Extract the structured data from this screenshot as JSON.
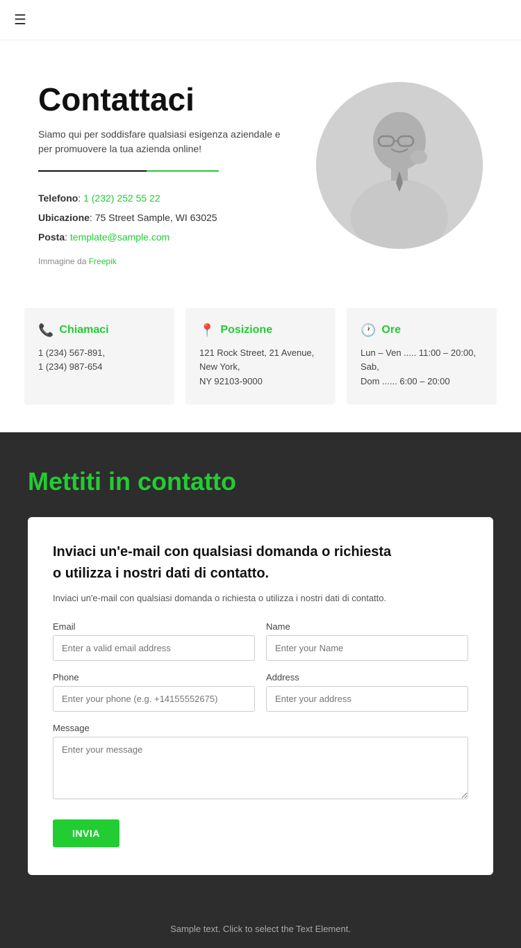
{
  "header": {
    "menu_icon": "☰"
  },
  "hero": {
    "title": "Contattaci",
    "subtitle": "Siamo qui per soddisfare qualsiasi esigenza aziendale e per promuovere la tua azienda online!",
    "telefono_label": "Telefono",
    "telefono_value": "1 (232) 252 55 22",
    "ubicazione_label": "Ubicazione",
    "ubicazione_value": "75 Street Sample, WI 63025",
    "posta_label": "Posta",
    "posta_value": "template@sample.com",
    "image_credit_prefix": "Immagine da",
    "image_credit_link": "Freepik"
  },
  "cards": [
    {
      "icon": "📞",
      "title": "Chiamaci",
      "line1": "1 (234) 567-891,",
      "line2": "1 (234) 987-654"
    },
    {
      "icon": "📍",
      "title": "Posizione",
      "line1": "121 Rock Street, 21 Avenue, New York,",
      "line2": "NY 92103-9000"
    },
    {
      "icon": "🕐",
      "title": "Ore",
      "line1": "Lun – Ven ..... 11:00 – 20:00, Sab,",
      "line2": "Dom  ...... 6:00 – 20:00"
    }
  ],
  "form_section": {
    "heading": "Mettiti in contatto",
    "card_title_line1": "Inviaci un'e-mail con qualsiasi domanda o richiesta",
    "card_title_line2": "o utilizza i nostri dati di contatto.",
    "description": "Inviaci un'e-mail con qualsiasi domanda o richiesta o utilizza i nostri dati di contatto.",
    "fields": {
      "email_label": "Email",
      "email_placeholder": "Enter a valid email address",
      "name_label": "Name",
      "name_placeholder": "Enter your Name",
      "phone_label": "Phone",
      "phone_placeholder": "Enter your phone (e.g. +14155552675)",
      "address_label": "Address",
      "address_placeholder": "Enter your address",
      "message_label": "Message",
      "message_placeholder": "Enter your message"
    },
    "submit_label": "INVIA"
  },
  "footer": {
    "text": "Sample text. Click to select the Text Element."
  }
}
